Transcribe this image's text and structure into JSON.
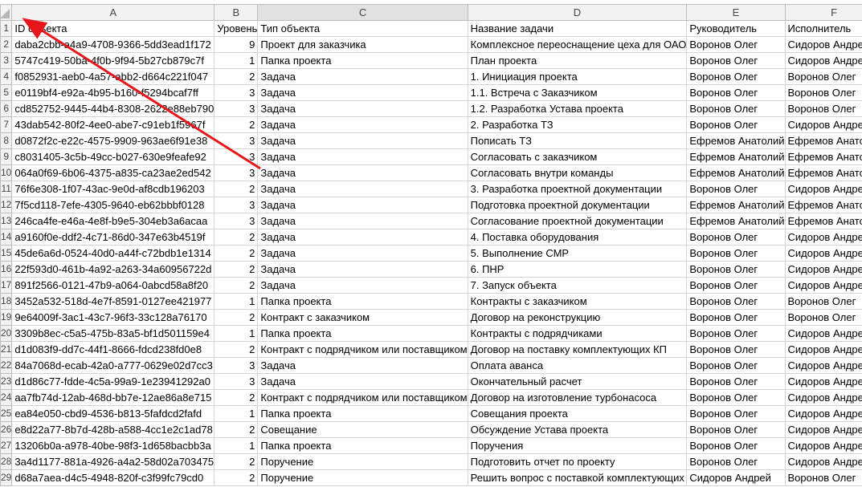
{
  "columns": [
    "A",
    "B",
    "C",
    "D",
    "E",
    "F"
  ],
  "rows": [
    [
      "1",
      "ID объекта",
      "Уровень",
      "Тип объекта",
      "Название задачи",
      "Руководитель",
      "Исполнитель"
    ],
    [
      "2",
      "daba2cbb-a4a9-4708-9366-5dd3ead1f172",
      "9",
      "Проект для заказчика",
      "Комплексное переоснащение цеха для ОАО",
      "Воронов Олег",
      "Сидоров Андрей"
    ],
    [
      "3",
      "5747c419-50ba-4f0b-9f94-5b27cb879c7f",
      "1",
      "Папка проекта",
      "План проекта",
      "Воронов Олег",
      "Сидоров Андрей"
    ],
    [
      "4",
      "f0852931-aeb0-4a57-abb2-d664c221f047",
      "2",
      "Задача",
      "1. Инициация проекта",
      "Воронов Олег",
      "Воронов Олег"
    ],
    [
      "5",
      "e0119bf4-e92a-4b95-b160-f5294bcaf7ff",
      "3",
      "Задача",
      "1.1. Встреча с Заказчиком",
      "Воронов Олег",
      "Воронов Олег"
    ],
    [
      "6",
      "cd852752-9445-44b4-8308-2622e88eb790",
      "3",
      "Задача",
      "1.2. Разработка Устава проекта",
      "Воронов Олег",
      "Воронов Олег"
    ],
    [
      "7",
      "43dab542-80f2-4ee0-abe7-c91eb1f5967f",
      "2",
      "Задача",
      "2. Разработка ТЗ",
      "Воронов Олег",
      "Сидоров Андрей"
    ],
    [
      "8",
      "d0872f2c-e22c-4575-9909-963ae6f91e38",
      "3",
      "Задача",
      "Пописать ТЗ",
      "Ефремов Анатолий",
      "Ефремов Анатолий"
    ],
    [
      "9",
      "c8031405-3c5b-49cc-b027-630e9feafe92",
      "3",
      "Задача",
      "Согласовать с заказчиком",
      "Ефремов Анатолий",
      "Ефремов Анатолий"
    ],
    [
      "10",
      "064a0f69-6b06-4375-a835-ca23ae2ed542",
      "3",
      "Задача",
      "Согласовать внутри команды",
      "Ефремов Анатолий",
      "Ефремов Анатолий"
    ],
    [
      "11",
      "76f6e308-1f07-43ac-9e0d-af8cdb196203",
      "2",
      "Задача",
      "3. Разработка проектной документации",
      "Воронов Олег",
      "Сидоров Андрей"
    ],
    [
      "12",
      "7f5cd118-7efe-4305-9640-eb62bbbf0128",
      "3",
      "Задача",
      "Подготовка проектной документации",
      "Ефремов Анатолий",
      "Ефремов Анатолий"
    ],
    [
      "13",
      "246ca4fe-e46a-4e8f-b9e5-304eb3a6acaa",
      "3",
      "Задача",
      "Согласование проектной документации",
      "Ефремов Анатолий",
      "Ефремов Анатолий"
    ],
    [
      "14",
      "a9160f0e-ddf2-4c71-86d0-347e63b4519f",
      "2",
      "Задача",
      "4. Поставка оборудования",
      "Воронов Олег",
      "Сидоров Андрей"
    ],
    [
      "15",
      "45de6a6d-0524-40d0-a44f-c72bdb1e1314",
      "2",
      "Задача",
      "5. Выполнение СМР",
      "Воронов Олег",
      "Сидоров Андрей"
    ],
    [
      "16",
      "22f593d0-461b-4a92-a263-34a60956722d",
      "2",
      "Задача",
      "6. ПНР",
      "Воронов Олег",
      "Сидоров Андрей"
    ],
    [
      "17",
      "891f2566-0121-47b9-a064-0abcd58a8f20",
      "2",
      "Задача",
      "7. Запуск объекта",
      "Воронов Олег",
      "Сидоров Андрей"
    ],
    [
      "18",
      "3452a532-518d-4e7f-8591-0127ee421977",
      "1",
      "Папка проекта",
      "Контракты с заказчиком",
      "Воронов Олег",
      "Воронов Олег"
    ],
    [
      "19",
      "9e64009f-3ac1-43c7-96f3-33c128a76170",
      "2",
      "Контракт с заказчиком",
      "Договор на реконструкцию",
      "Воронов Олег",
      "Воронов Олег"
    ],
    [
      "20",
      "3309b8ec-c5a5-475b-83a5-bf1d501159e4",
      "1",
      "Папка проекта",
      "Контракты с подрядчиками",
      "Воронов Олег",
      "Сидоров Андрей"
    ],
    [
      "21",
      "d1d083f9-dd7c-44f1-8666-fdcd238fd0e8",
      "2",
      "Контракт с подрядчиком или поставщиком",
      "Договор на поставку комплектующих КП",
      "Воронов Олег",
      "Сидоров Андрей"
    ],
    [
      "22",
      "84a7068d-ecab-42a0-a777-0629e02d7cc3",
      "3",
      "Задача",
      "Оплата аванса",
      "Воронов Олег",
      "Сидоров Андрей"
    ],
    [
      "23",
      "d1d86c77-fdde-4c5a-99a9-1e23941292a0",
      "3",
      "Задача",
      "Окончательный расчет",
      "Воронов Олег",
      "Сидоров Андрей"
    ],
    [
      "24",
      "aa7fb74d-12ab-468d-bb7e-12ae86a8e715",
      "2",
      "Контракт с подрядчиком или поставщиком",
      "Договор на изготовление турбонасоса",
      "Воронов Олег",
      "Сидоров Андрей"
    ],
    [
      "25",
      "ea84e050-cbd9-4536-b813-5fafdcd2fafd",
      "1",
      "Папка проекта",
      "Совещания проекта",
      "Воронов Олег",
      "Сидоров Андрей"
    ],
    [
      "26",
      "e8d22a77-8b7d-428b-a588-4cc1e2c1ad78",
      "2",
      "Совещание",
      "Обсуждение Устава проекта",
      "Воронов Олег",
      "Сидоров Андрей"
    ],
    [
      "27",
      "13206b0a-a978-40be-98f3-1d658bacbb3a",
      "1",
      "Папка проекта",
      "Поручения",
      "Воронов Олег",
      "Сидоров Андрей"
    ],
    [
      "28",
      "3a4d1177-881a-4926-a4a2-58d02a703475",
      "2",
      "Поручение",
      "Подготовить отчет по проекту",
      "Воронов Олег",
      "Сидоров Андрей"
    ],
    [
      "29",
      "d68a7aea-d4c5-4948-820f-c3f99fc79cd0",
      "2",
      "Поручение",
      "Решить вопрос с поставкой комплектующих",
      "Сидоров Андрей",
      "Воронов Олег"
    ]
  ],
  "annotation": {
    "arrow_color": "#e8161b"
  }
}
